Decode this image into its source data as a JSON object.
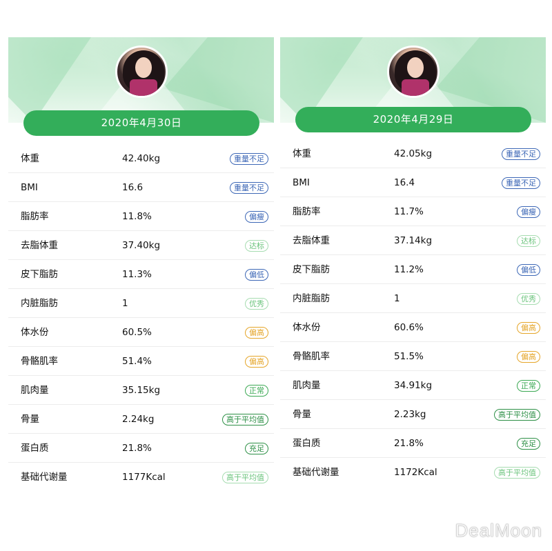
{
  "panels": [
    {
      "date": "2020年4月30日",
      "colors": {
        "header": "#bfe8cb",
        "date_bar": "#33ae5a"
      },
      "rows": [
        {
          "label": "体重",
          "value": "42.40kg",
          "badge": "重量不足",
          "badge_color": "blue"
        },
        {
          "label": "BMI",
          "value": "16.6",
          "badge": "重量不足",
          "badge_color": "blue"
        },
        {
          "label": "脂肪率",
          "value": "11.8%",
          "badge": "偏瘦",
          "badge_color": "blue"
        },
        {
          "label": "去脂体重",
          "value": "37.40kg",
          "badge": "达标",
          "badge_color": "lightgreen"
        },
        {
          "label": "皮下脂肪",
          "value": "11.3%",
          "badge": "偏低",
          "badge_color": "blue"
        },
        {
          "label": "内脏脂肪",
          "value": "1",
          "badge": "优秀",
          "badge_color": "lightgreen"
        },
        {
          "label": "体水份",
          "value": "60.5%",
          "badge": "偏高",
          "badge_color": "orange"
        },
        {
          "label": "骨骼肌率",
          "value": "51.4%",
          "badge": "偏高",
          "badge_color": "orange"
        },
        {
          "label": "肌肉量",
          "value": "35.15kg",
          "badge": "正常",
          "badge_color": "green"
        },
        {
          "label": "骨量",
          "value": "2.24kg",
          "badge": "高于平均值",
          "badge_color": "darkgreen"
        },
        {
          "label": "蛋白质",
          "value": "21.8%",
          "badge": "充足",
          "badge_color": "darkgreen"
        },
        {
          "label": "基础代谢量",
          "value": "1177Kcal",
          "badge": "高于平均值",
          "badge_color": "lightgreen"
        }
      ]
    },
    {
      "date": "2020年4月29日",
      "colors": {
        "header": "#bfe8cb",
        "date_bar": "#33ae5a"
      },
      "rows": [
        {
          "label": "体重",
          "value": "42.05kg",
          "badge": "重量不足",
          "badge_color": "blue"
        },
        {
          "label": "BMI",
          "value": "16.4",
          "badge": "重量不足",
          "badge_color": "blue"
        },
        {
          "label": "脂肪率",
          "value": "11.7%",
          "badge": "偏瘦",
          "badge_color": "blue"
        },
        {
          "label": "去脂体重",
          "value": "37.14kg",
          "badge": "达标",
          "badge_color": "lightgreen"
        },
        {
          "label": "皮下脂肪",
          "value": "11.2%",
          "badge": "偏低",
          "badge_color": "blue"
        },
        {
          "label": "内脏脂肪",
          "value": "1",
          "badge": "优秀",
          "badge_color": "lightgreen"
        },
        {
          "label": "体水份",
          "value": "60.6%",
          "badge": "偏高",
          "badge_color": "orange"
        },
        {
          "label": "骨骼肌率",
          "value": "51.5%",
          "badge": "偏高",
          "badge_color": "orange"
        },
        {
          "label": "肌肉量",
          "value": "34.91kg",
          "badge": "正常",
          "badge_color": "green"
        },
        {
          "label": "骨量",
          "value": "2.23kg",
          "badge": "高于平均值",
          "badge_color": "darkgreen"
        },
        {
          "label": "蛋白质",
          "value": "21.8%",
          "badge": "充足",
          "badge_color": "darkgreen"
        },
        {
          "label": "基础代谢量",
          "value": "1172Kcal",
          "badge": "高于平均值",
          "badge_color": "lightgreen"
        }
      ]
    }
  ],
  "watermark": "DealMoon"
}
